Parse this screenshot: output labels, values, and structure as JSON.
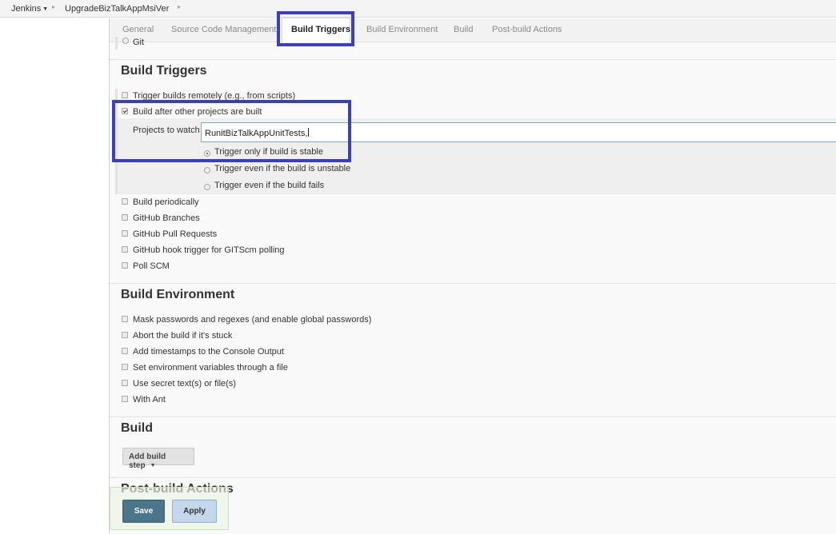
{
  "breadcrumb": {
    "items": [
      "Jenkins",
      "UpgradeBizTalkAppMsiVer"
    ]
  },
  "tabs": [
    {
      "label": "General"
    },
    {
      "label": "Source Code Management"
    },
    {
      "label": "Build Triggers"
    },
    {
      "label": "Build Environment"
    },
    {
      "label": "Build"
    },
    {
      "label": "Post-build Actions"
    }
  ],
  "scm": {
    "git_label": "Git"
  },
  "build_triggers": {
    "title": "Build Triggers",
    "remote": {
      "label": "Trigger builds remotely (e.g., from scripts)",
      "checked": false
    },
    "after_other": {
      "label": "Build after other projects are built",
      "checked": true
    },
    "projects_to_watch": {
      "label": "Projects to watch",
      "value": "RunitBizTalkAppUnitTests,"
    },
    "radios": [
      {
        "label": "Trigger only if build is stable",
        "checked": true
      },
      {
        "label": "Trigger even if the build is unstable",
        "checked": false
      },
      {
        "label": "Trigger even if the build fails",
        "checked": false
      }
    ],
    "others": [
      {
        "label": "Build periodically",
        "checked": false
      },
      {
        "label": "GitHub Branches",
        "checked": false
      },
      {
        "label": "GitHub Pull Requests",
        "checked": false
      },
      {
        "label": "GitHub hook trigger for GITScm polling",
        "checked": false
      },
      {
        "label": "Poll SCM",
        "checked": false
      }
    ]
  },
  "build_environment": {
    "title": "Build Environment",
    "options": [
      {
        "label": "Mask passwords and regexes (and enable global passwords)",
        "checked": false
      },
      {
        "label": "Abort the build if it's stuck",
        "checked": false
      },
      {
        "label": "Add timestamps to the Console Output",
        "checked": false
      },
      {
        "label": "Set environment variables through a file",
        "checked": false
      },
      {
        "label": "Use secret text(s) or file(s)",
        "checked": false
      },
      {
        "label": "With Ant",
        "checked": false
      }
    ]
  },
  "build": {
    "title": "Build",
    "add_step_label": "Add build step"
  },
  "post_build": {
    "title": "Post-build Actions"
  },
  "actions": {
    "save_label": "Save",
    "apply_label": "Apply"
  },
  "colors": {
    "highlight": "#3f3fb5",
    "save_button": "#4b758b",
    "apply_button": "#c4d7ec"
  }
}
